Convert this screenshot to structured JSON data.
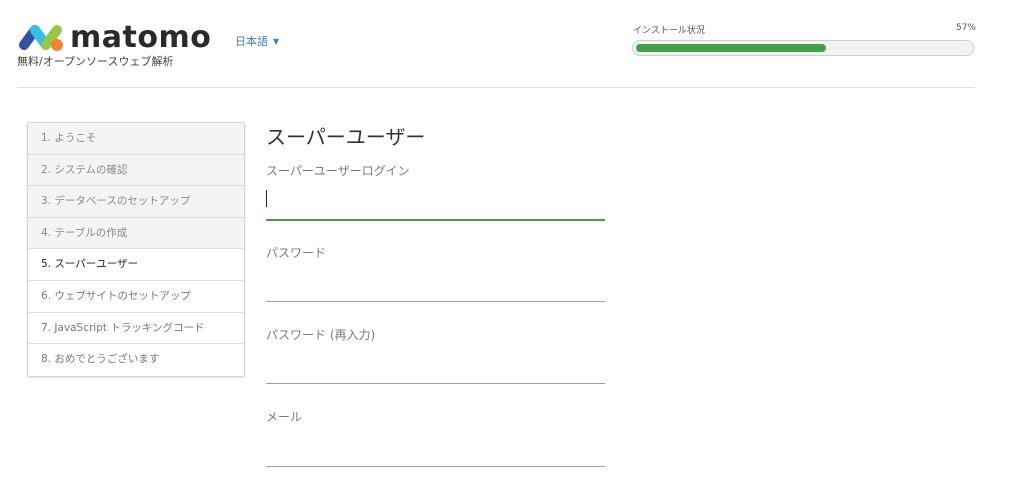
{
  "header": {
    "logo_text": "matomo",
    "tagline": "無料/オープンソースウェブ解析",
    "language": "日本語",
    "install_status_label": "インストール状況",
    "install_percent_label": "57%",
    "install_progress": 0.57,
    "colors": {
      "progress": "#43a047",
      "link": "#3f7fc1"
    }
  },
  "steps": [
    {
      "label": "1. ようこそ",
      "state": "done"
    },
    {
      "label": "2. システムの確認",
      "state": "done"
    },
    {
      "label": "3. データベースのセットアップ",
      "state": "done"
    },
    {
      "label": "4. テーブルの作成",
      "state": "done"
    },
    {
      "label": "5. スーパーユーザー",
      "state": "current"
    },
    {
      "label": "6. ウェブサイトのセットアップ",
      "state": "todo"
    },
    {
      "label": "7. JavaScript トラッキングコード",
      "state": "todo"
    },
    {
      "label": "8. おめでとうございます",
      "state": "todo"
    }
  ],
  "form": {
    "title": "スーパーユーザー",
    "login_label": "スーパーユーザーログイン",
    "login_value": "",
    "password_label": "パスワード",
    "password_value": "",
    "password_confirm_label": "パスワード (再入力)",
    "password_confirm_value": "",
    "email_label": "メール",
    "email_value": ""
  }
}
